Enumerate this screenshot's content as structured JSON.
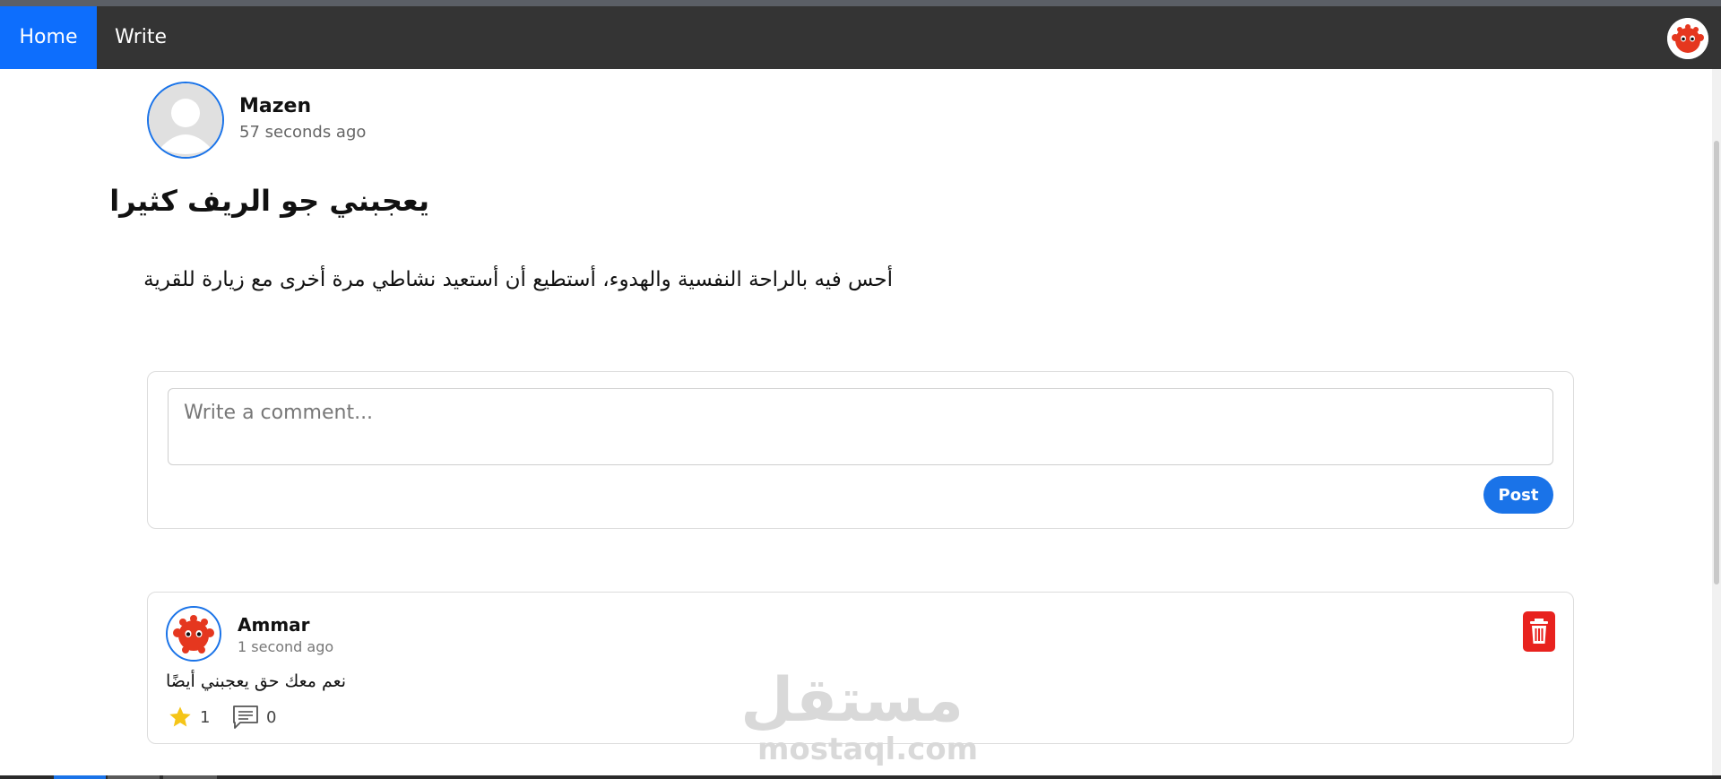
{
  "nav": {
    "home_label": "Home",
    "write_label": "Write"
  },
  "post": {
    "author": "Mazen",
    "time": "57 seconds ago",
    "title": "يعجبني جو الريف كثيرا",
    "body": "أحس فيه بالراحة النفسية والهدوء، أستطيع أن أستعيد نشاطي مرة أخرى مع زيارة للقرية"
  },
  "comment_form": {
    "placeholder": "Write a comment...",
    "value": "",
    "post_label": "Post"
  },
  "comments": [
    {
      "author": "Ammar",
      "time": "1 second ago",
      "text": "نعم معك حق يعجبني أيضًا",
      "stars": "1",
      "replies": "0"
    }
  ],
  "watermark": {
    "arabic": "مستقل",
    "latin": "mostaql.com"
  },
  "colors": {
    "navbar": "#343434",
    "accent": "#0d6efd",
    "button": "#1a73e8",
    "delete": "#e8221e",
    "star": "#f5c518"
  },
  "icons": [
    "user-avatar-icon",
    "crab-avatar-icon",
    "star-icon",
    "comment-icon",
    "trash-icon"
  ]
}
